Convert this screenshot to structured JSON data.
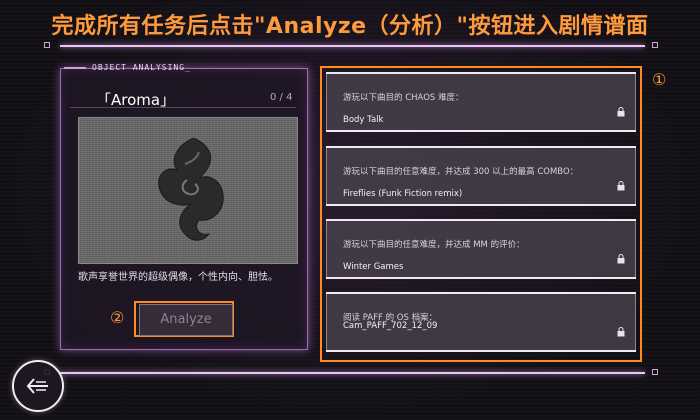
{
  "instruction": "完成所有任务后点击\"Analyze（分析）\"按钮进入剧情谱面",
  "panel": {
    "header": "OBJECT ANALYSING_",
    "name": "「Aroma」",
    "progress": "0 / 4",
    "description": "歌声享誉世界的超级偶像，个性内向、胆怯。",
    "analyze_label": "Analyze"
  },
  "markers": {
    "first": "①",
    "second": "②"
  },
  "quests": [
    {
      "requirement": "游玩以下曲目的 CHAOS 难度：",
      "song": "Body Talk",
      "locked": true
    },
    {
      "requirement": "游玩以下曲目的任意难度，并达成 300 以上的最高 COMBO：",
      "song": "Fireflies (Funk Fiction remix)",
      "locked": true
    },
    {
      "requirement": "游玩以下曲目的任意难度，并达成 MM 的评价：",
      "song": "Winter Games",
      "locked": true
    },
    {
      "requirement": "阅读 PAFF 的 OS 档案：",
      "song": "Cam_PAFF_702_12_09",
      "locked": true
    }
  ],
  "colors": {
    "highlight": "#ff8a1e",
    "accent": "#ff9a3c",
    "glow": "#d08ae8"
  }
}
